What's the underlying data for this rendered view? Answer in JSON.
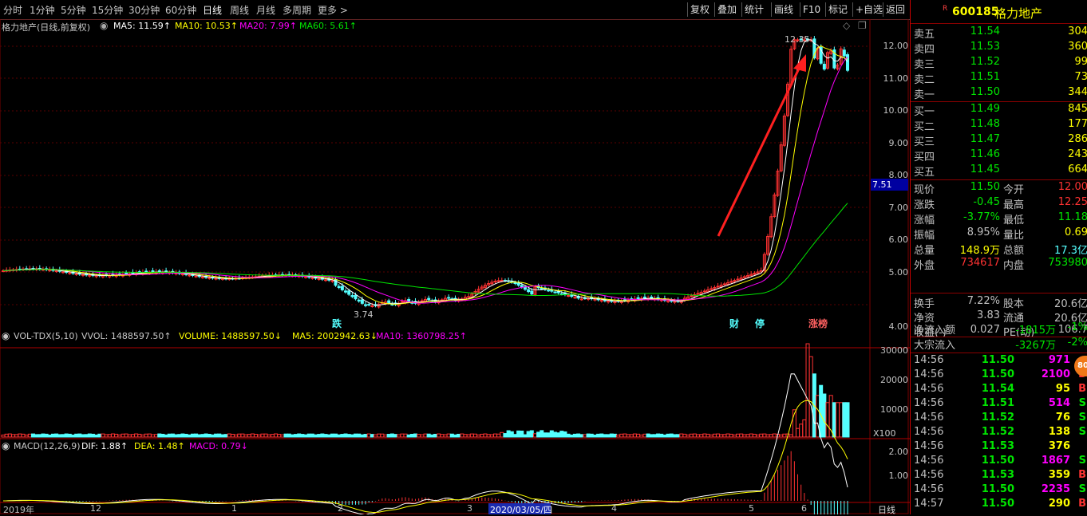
{
  "toolbar": {
    "periods": [
      "分时",
      "1分钟",
      "5分钟",
      "15分钟",
      "30分钟",
      "60分钟",
      "日线",
      "周线",
      "月线",
      "多周期",
      "更多 >"
    ],
    "active_period": "日线",
    "right_buttons": [
      "复权",
      "叠加",
      "统计",
      "画线",
      "F10",
      "标记",
      "+自选",
      "返回"
    ]
  },
  "main_legend": {
    "title": "格力地产(日线,前复权)",
    "ma5": "MA5: 11.59↑",
    "ma10": "MA10: 10.53↑",
    "ma20": "MA20: 7.99↑",
    "ma60": "MA60: 5.61↑"
  },
  "price_axis": [
    "12.00",
    "11.00",
    "10.00",
    "9.00",
    "8.00",
    "7.00",
    "6.00",
    "5.00",
    "4.00"
  ],
  "cursor_price": "7.51",
  "annotations": {
    "high": "12.35",
    "low": "3.74",
    "event_die": "跌",
    "event_cai": "财",
    "event_ting": "停",
    "event_bang": "涨榜"
  },
  "vol_legend": {
    "title": "VOL-TDX(5,10)",
    "vvol": "VVOL: 1488597.50↑",
    "volume": "VOLUME: 1488597.50↓",
    "ma5": "MA5: 2002942.63↓",
    "ma10": "MA10: 1360798.25↑"
  },
  "vol_axis": [
    "30000",
    "20000",
    "10000"
  ],
  "vol_unit": "X100",
  "macd_legend": {
    "title": "MACD(12,26,9)",
    "dif": "DIF: 1.88↑",
    "dea": "DEA: 1.48↑",
    "macd": "MACD: 0.79↓"
  },
  "macd_axis": [
    "2.00",
    "1.00"
  ],
  "date_axis": [
    "2019年",
    "12",
    "1",
    "2",
    "3",
    "4",
    "5",
    "6"
  ],
  "date_cursor": "2020/03/05/四",
  "period_label": "日线",
  "colors": {
    "up": "#ff3232",
    "down": "#54ffff",
    "ma5": "#ffffff",
    "ma10": "#ffff00",
    "ma20": "#ff00ff",
    "ma60": "#00e600"
  },
  "stock": {
    "code": "600185",
    "name": "格力地产",
    "badge": "R"
  },
  "asks": [
    {
      "label": "卖五",
      "price": "11.54",
      "vol": "304"
    },
    {
      "label": "卖四",
      "price": "11.53",
      "vol": "360"
    },
    {
      "label": "卖三",
      "price": "11.52",
      "vol": "99"
    },
    {
      "label": "卖二",
      "price": "11.51",
      "vol": "73"
    },
    {
      "label": "卖一",
      "price": "11.50",
      "vol": "344"
    }
  ],
  "bids": [
    {
      "label": "买一",
      "price": "11.49",
      "vol": "845"
    },
    {
      "label": "买二",
      "price": "11.48",
      "vol": "177"
    },
    {
      "label": "买三",
      "price": "11.47",
      "vol": "286"
    },
    {
      "label": "买四",
      "price": "11.46",
      "vol": "243"
    },
    {
      "label": "买五",
      "price": "11.45",
      "vol": "664"
    }
  ],
  "quote": [
    {
      "l1": "现价",
      "v1": "11.50",
      "l2": "今开",
      "v2": "12.00"
    },
    {
      "l1": "涨跌",
      "v1": "-0.45",
      "l2": "最高",
      "v2": "12.25"
    },
    {
      "l1": "涨幅",
      "v1": "-3.77%",
      "l2": "最低",
      "v2": "11.18"
    },
    {
      "l1": "振幅",
      "v1": "8.95%",
      "l2": "量比",
      "v2": "0.69"
    },
    {
      "l1": "总量",
      "v1": "148.9万",
      "l2": "总额",
      "v2": "17.3亿"
    },
    {
      "l1": "外盘",
      "v1": "734617",
      "l2": "内盘",
      "v2": "753980"
    }
  ],
  "stats": [
    {
      "l1": "换手",
      "v1": "7.22%",
      "l2": "股本",
      "v2": "20.6亿"
    },
    {
      "l1": "净资",
      "v1": "3.83",
      "l2": "流通",
      "v2": "20.6亿"
    },
    {
      "l1": "收益(-)",
      "v1": "0.027",
      "l2": "PE(动)",
      "v2": "106.7"
    }
  ],
  "flows": [
    {
      "label": "净流入额",
      "value": "-1815万",
      "pct": "-1%"
    },
    {
      "label": "大宗流入",
      "value": "-3267万",
      "pct": "-2%"
    }
  ],
  "ticks": [
    {
      "time": "14:56",
      "price": "11.50",
      "vol": "971",
      "dir": ""
    },
    {
      "time": "14:56",
      "price": "11.50",
      "vol": "2100",
      "dir": "B"
    },
    {
      "time": "14:56",
      "price": "11.54",
      "vol": "95",
      "dir": "B"
    },
    {
      "time": "14:56",
      "price": "11.51",
      "vol": "514",
      "dir": "S"
    },
    {
      "time": "14:56",
      "price": "11.52",
      "vol": "76",
      "dir": "S"
    },
    {
      "time": "14:56",
      "price": "11.52",
      "vol": "138",
      "dir": "S"
    },
    {
      "time": "14:56",
      "price": "11.53",
      "vol": "376",
      "dir": ""
    },
    {
      "time": "14:56",
      "price": "11.50",
      "vol": "1867",
      "dir": "S"
    },
    {
      "time": "14:56",
      "price": "11.53",
      "vol": "359",
      "dir": "B"
    },
    {
      "time": "14:56",
      "price": "11.50",
      "vol": "2235",
      "dir": "S"
    },
    {
      "time": "14:57",
      "price": "11.50",
      "vol": "290",
      "dir": "B"
    }
  ],
  "float_badge": "80"
}
